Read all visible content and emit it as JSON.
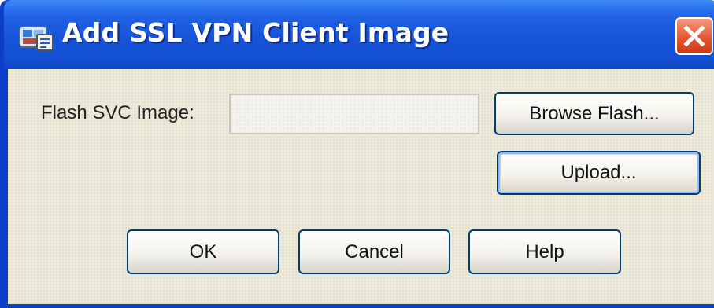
{
  "window": {
    "title": "Add SSL VPN Client Image",
    "icon": "asdm-app-icon",
    "close_icon": "close-icon"
  },
  "form": {
    "flash_svc_image_label": "Flash SVC Image:",
    "flash_svc_image_value": "",
    "flash_svc_image_placeholder": ""
  },
  "buttons": {
    "browse_flash": "Browse Flash...",
    "upload": "Upload...",
    "ok": "OK",
    "cancel": "Cancel",
    "help": "Help"
  },
  "colors": {
    "titlebar": "#1653d8",
    "window_frame": "#0b3fc8",
    "client_background": "#ece9d8",
    "close_button": "#e2522c",
    "button_border": "#003c74"
  }
}
